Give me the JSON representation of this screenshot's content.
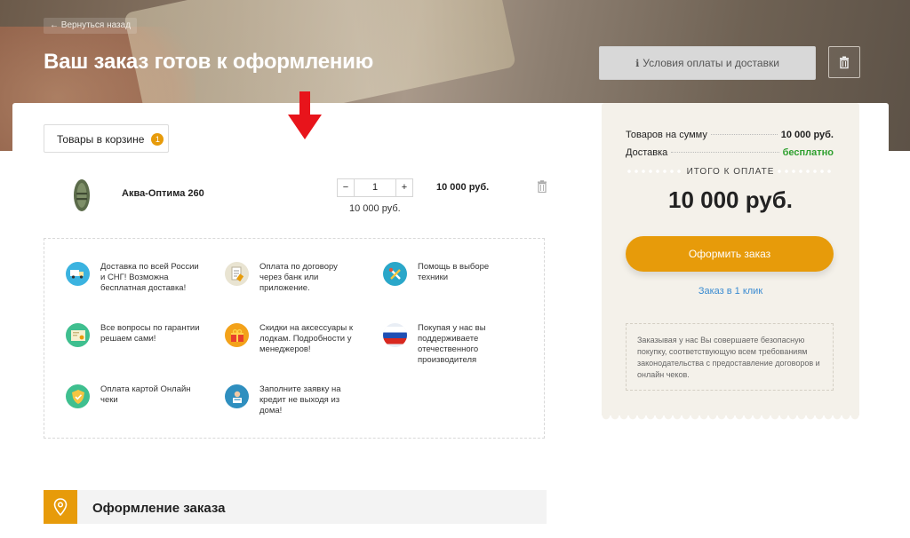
{
  "header": {
    "back_link": "← Вернуться назад",
    "title": "Ваш заказ готов к оформлению",
    "terms_button": "Условия оплаты и доставки"
  },
  "cart": {
    "tab_label": "Товары в корзине",
    "count": "1",
    "item": {
      "name": "Аква-Оптима 260",
      "minus": "−",
      "quantity": "1",
      "plus": "+",
      "unit_price": "10 000 руб.",
      "total": "10 000 руб."
    }
  },
  "benefits": [
    {
      "text": "Доставка по всей России и СНГ! Возможна бесплатная доставка!",
      "icon": "delivery-icon",
      "color": "#3bb3e0"
    },
    {
      "text": "Оплата по договору через банк или приложение.",
      "icon": "contract-icon",
      "color": "#e9e4d2"
    },
    {
      "text": "Помощь в выборе техники",
      "icon": "tools-icon",
      "color": "#2aa7c9"
    },
    {
      "text": "Все вопросы по гарантии решаем сами!",
      "icon": "warranty-icon",
      "color": "#3fbf8f"
    },
    {
      "text": "Скидки на аксессуары к лодкам. Подробности у менеджеров!",
      "icon": "gift-icon",
      "color": "#f3a21a"
    },
    {
      "text": "Покупая у нас вы поддерживаете отечественного производителя",
      "icon": "russia-flag-icon",
      "color": "#e9eef5"
    },
    {
      "text": "Оплата картой Онлайн чеки",
      "icon": "shield-icon",
      "color": "#3fbf8f"
    },
    {
      "text": "Заполните заявку на кредит не выходя из дома!",
      "icon": "credit-icon",
      "color": "#2f8fbf"
    }
  ],
  "summary": {
    "goods_label": "Товаров на сумму",
    "goods_value": "10 000 руб.",
    "delivery_label": "Доставка",
    "delivery_value": "бесплатно",
    "total_label": "ИТОГО К ОПЛАТЕ",
    "total_value": "10 000 руб.",
    "order_button": "Оформить заказ",
    "one_click": "Заказ в 1 клик",
    "note": "Заказывая у нас Вы совершаете безопасную покупку, соответствующую всем требованиям законодательства с предоставление договоров и онлайн чеков."
  },
  "checkout": {
    "title": "Оформление заказа"
  },
  "colors": {
    "accent": "#e79b0a",
    "link": "#3a8bd1",
    "free": "#2fa02f",
    "arrow": "#e8141b"
  }
}
